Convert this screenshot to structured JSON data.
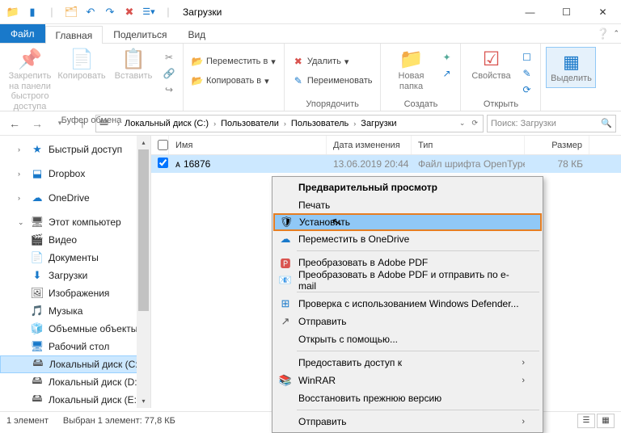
{
  "window": {
    "title": "Загрузки"
  },
  "tabs": {
    "file": "Файл",
    "home": "Главная",
    "share": "Поделиться",
    "view": "Вид"
  },
  "ribbon": {
    "g1": {
      "pin": "Закрепить на панели быстрого доступа",
      "copy": "Копировать",
      "paste": "Вставить",
      "label": "Буфер обмена"
    },
    "g2": {
      "move": "Переместить в",
      "copy": "Копировать в",
      "del": "Удалить",
      "ren": "Переименовать",
      "label": "Упорядочить"
    },
    "g3": {
      "new": "Новая папка",
      "label": "Создать"
    },
    "g4": {
      "prop": "Свойства",
      "label": "Открыть"
    },
    "g5": {
      "sel": "Выделить"
    }
  },
  "breadcrumb": [
    "Локальный диск (C:)",
    "Пользователи",
    "Пользователь",
    "Загрузки"
  ],
  "search": {
    "placeholder": "Поиск: Загрузки"
  },
  "nav": {
    "quick": "Быстрый доступ",
    "dropbox": "Dropbox",
    "onedrive": "OneDrive",
    "thispc": "Этот компьютер",
    "items": [
      "Видео",
      "Документы",
      "Загрузки",
      "Изображения",
      "Музыка",
      "Объемные объекты",
      "Рабочий стол",
      "Локальный диск (C:)",
      "Локальный диск (D:)",
      "Локальный диск (E:)"
    ]
  },
  "cols": {
    "name": "Имя",
    "date": "Дата изменения",
    "type": "Тип",
    "size": "Размер"
  },
  "file": {
    "name": "16876",
    "date": "13.06.2019 20:44",
    "type": "Файл шрифта OpenType",
    "size": "78 КБ"
  },
  "ctx": {
    "preview": "Предварительный просмотр",
    "print": "Печать",
    "install": "Установить",
    "onedrive": "Переместить в OneDrive",
    "pdf": "Преобразовать в Adobe PDF",
    "pdfemail": "Преобразовать в Adobe PDF и отправить по e-mail",
    "defender": "Проверка с использованием Windows Defender...",
    "send": "Отправить",
    "openwith": "Открыть с помощью...",
    "share": "Предоставить доступ к",
    "winrar": "WinRAR",
    "restore": "Восстановить прежнюю версию",
    "sendto": "Отправить"
  },
  "status": {
    "count": "1 элемент",
    "sel": "Выбран 1 элемент: 77,8 КБ"
  }
}
